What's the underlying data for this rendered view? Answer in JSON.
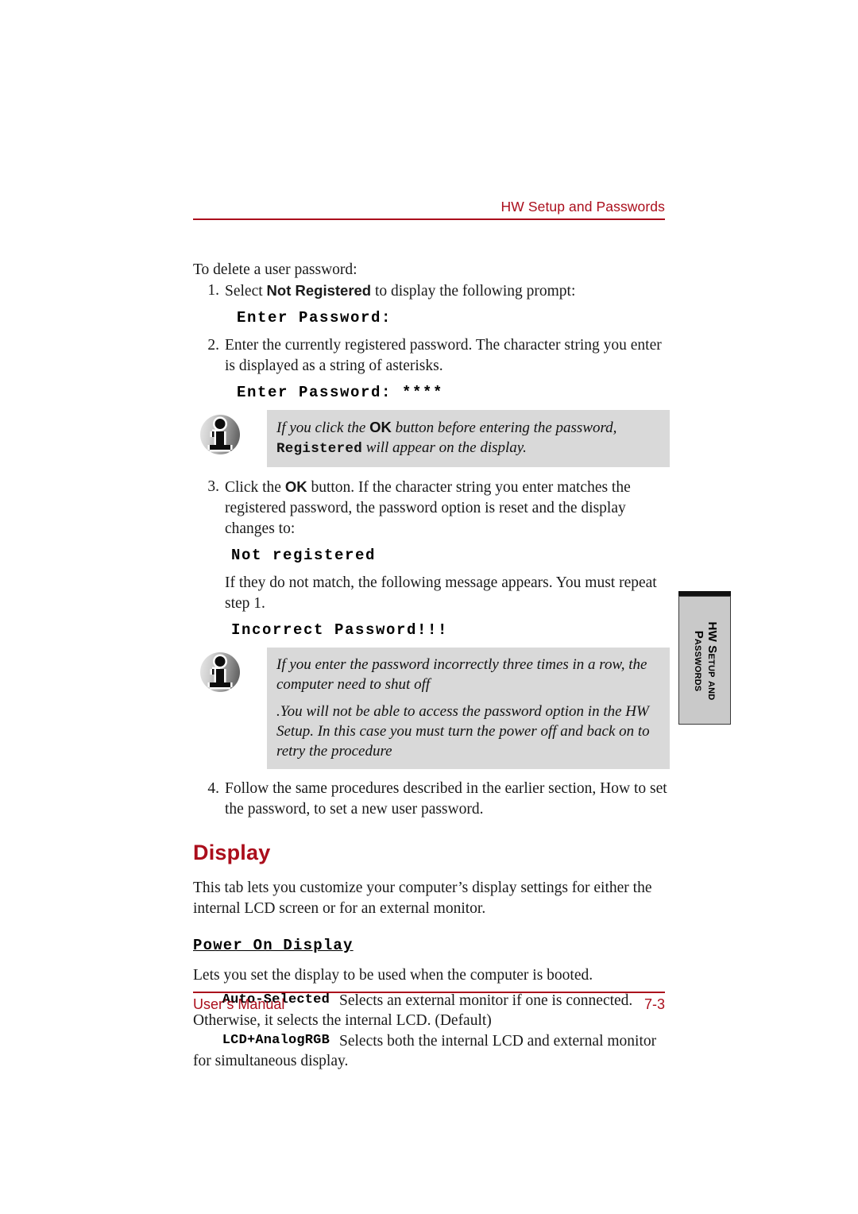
{
  "header": {
    "title": "HW Setup and Passwords"
  },
  "body": {
    "intro": "To delete a user password:",
    "step1": {
      "number": "1.",
      "text_before": "Select ",
      "bold": "Not Registered",
      "text_after": " to display the following prompt:"
    },
    "code1": "Enter Password:",
    "step2": {
      "number": "2.",
      "text": "Enter the currently registered password. The character string you enter is displayed as a string of asterisks."
    },
    "code2": "Enter Password: ****",
    "note1": {
      "icon": "info-icon",
      "line_before": "If you click the ",
      "ok": "OK",
      "line_middle": " button before entering the password,",
      "mono": "Registered",
      "line_after": " will appear on the display."
    },
    "step3": {
      "number": "3.",
      "text_before": "Click the ",
      "ok": "OK",
      "text_after": " button. If the character string you enter matches the registered password, the password option is reset and the display changes to:"
    },
    "code3": "Not registered",
    "step3_cont": "If they do not match, the following message appears. You must repeat step 1.",
    "code4": "Incorrect Password!!!",
    "note2": {
      "icon": "info-icon",
      "para1": "If you enter the password incorrectly three times in a row, the computer need to shut off",
      "para2": ".You will not be able to access the password option in the HW Setup. In this case you must turn the power off and back on to retry the procedure"
    },
    "step4": {
      "number": "4.",
      "text": "Follow the same procedures described in the earlier section, How to set the password, to set a new user password."
    }
  },
  "display_section": {
    "heading": "Display",
    "paragraph": "This tab lets you customize your computer’s display settings for either the internal LCD screen or for an external monitor.",
    "sub_heading": "Power On Display",
    "sub_paragraph": "Lets you set the display to be used when the computer is booted.",
    "options": [
      {
        "term": "Auto-Selected",
        "description": "Selects an external monitor if one is connected. Otherwise, it selects the internal LCD. (Default)"
      },
      {
        "term": "LCD+AnalogRGB",
        "description": "Selects both the internal LCD and external monitor for simultaneous display."
      }
    ]
  },
  "side_tab": {
    "line1": "HW Setup and",
    "line2": "Passwords"
  },
  "footer": {
    "left": "User’s Manual",
    "right": "7-3"
  },
  "colors": {
    "accent_red": "#AB0E1C",
    "note_background": "#d9d9d9",
    "side_tab_background": "#c9c9c9"
  }
}
